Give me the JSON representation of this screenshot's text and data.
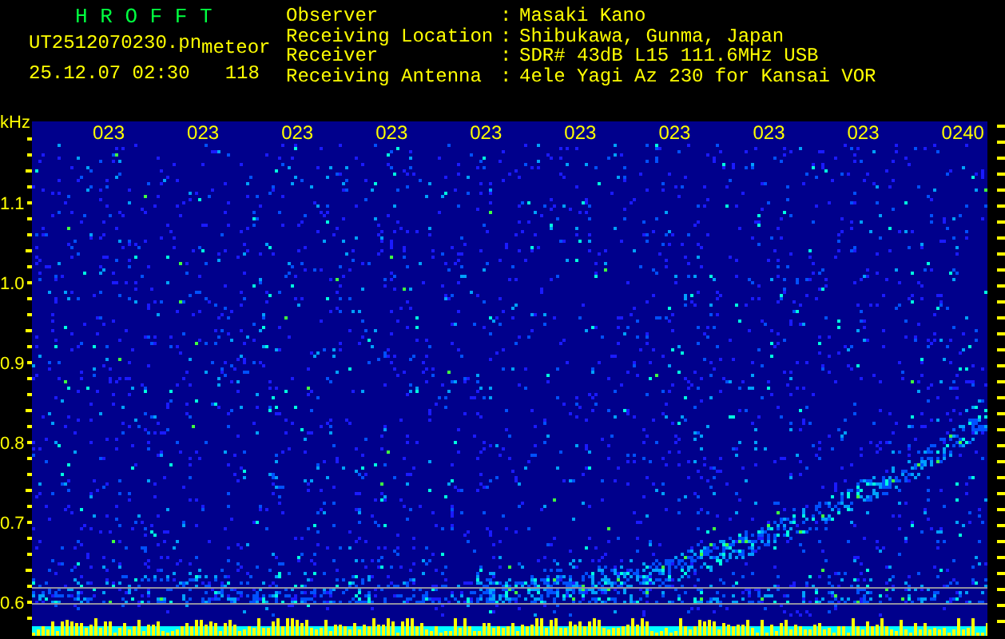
{
  "app_title": "H R O F F T",
  "file_name": "UT2512070230.pn",
  "mode": "meteor",
  "timestamp": "25.12.07 02:30",
  "count": "118",
  "station_info": [
    {
      "label": "Observer",
      "separator": ":",
      "value": "Masaki Kano"
    },
    {
      "label": "Receiving Location",
      "separator": ":",
      "value": "Shibukawa, Gunma, Japan"
    },
    {
      "label": "Receiver",
      "separator": ":",
      "value": "SDR# 43dB L15 111.6MHz USB"
    },
    {
      "label": "Receiving Antenna",
      "separator": ":",
      "value": "4ele Yagi Az 230 for Kansai VOR"
    }
  ],
  "spectrogram": {
    "unit": "kHz",
    "freq_ticks": [
      "1.1",
      "1.0",
      "0.9",
      "0.8",
      "0.7",
      "0.6"
    ],
    "time_ticks": [
      "023",
      "023",
      "023",
      "023",
      "023",
      "023",
      "023",
      "023",
      "023",
      "0240"
    ]
  }
}
